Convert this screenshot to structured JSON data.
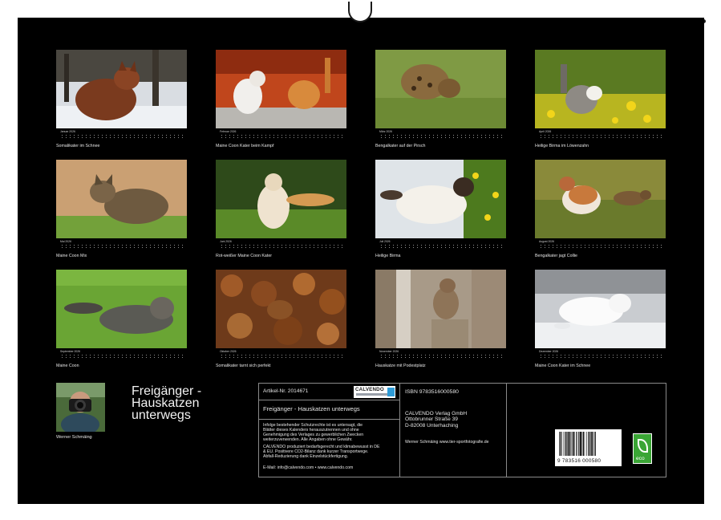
{
  "title": "Freigänger -\nHauskatzen\nunterwegs",
  "author": {
    "name": "Werner Schmäing"
  },
  "months": [
    {
      "name": "Januar 2026",
      "caption": "Somalikater im Schnee"
    },
    {
      "name": "Februar 2026",
      "caption": "Maine Coon Kater beim Kampf"
    },
    {
      "name": "März 2026",
      "caption": "Bengalkater auf der Pirsch"
    },
    {
      "name": "April 2026",
      "caption": "Heilige Birma im Löwenzahn"
    },
    {
      "name": "Mai 2026",
      "caption": "Maine Coon Mix"
    },
    {
      "name": "Juni 2026",
      "caption": "Rot-weißer Maine Coon Kater"
    },
    {
      "name": "Juli 2026",
      "caption": "Heilige Birma"
    },
    {
      "name": "August 2026",
      "caption": "Bengalkater jagt Collie"
    },
    {
      "name": "September 2026",
      "caption": "Maine Coon"
    },
    {
      "name": "Oktober 2026",
      "caption": "Somalikater tarnt sich perfekt"
    },
    {
      "name": "November 2026",
      "caption": "Hauskatze mit Podestplatz"
    },
    {
      "name": "Dezember 2026",
      "caption": "Maine Coon Kater im Schnee"
    }
  ],
  "info": {
    "article_no": "Artikel-Nr. 2014671",
    "logo_text": "CALVENDO",
    "calendar_title": "Freigänger - Hauskatzen unterwegs",
    "legal": "Infolge bestehender Schutzrechte ist es untersagt, die\nBlätter dieses Kalenders herauszutrennen und ohne\nGenehmigung des Verlages zu gewerblichen Zwecken\nweiterzuverwenden. Alle Angaben ohne Gewähr.",
    "climate": "CALVENDO produziert bedarfsgerecht und klimabewusst in DE\n& EU. Positivere CO2-Bilanz dank kurzer Transportwege.\nAbfall-Reduzierung dank Einzelstückfertigung.",
    "email": "E-Mail: info@calvendo.com • www.calvendo.com",
    "isbn": "ISBN 9783516000580",
    "publisher": "CALVENDO Verlag GmbH\nOttobrunner Straße 39\nD-82008 Unterhaching",
    "photographer": "Werner Schmäing www.tier-sportfotografie.de",
    "barcode_digits": "9 783516 000580",
    "eco_label": "eco"
  },
  "colors": {
    "sheet": "#000000",
    "eco": "#3aa535",
    "logo_accent": "#2e9bd6"
  }
}
